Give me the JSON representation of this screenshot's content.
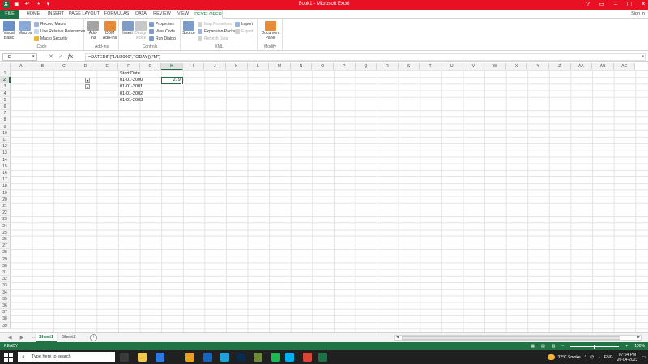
{
  "titlebar": {
    "title": "Book1 - Microsoft Excel",
    "qat": [
      "X",
      "▣",
      "↶",
      "↷",
      "▾"
    ],
    "controls": [
      "?",
      "▭",
      "–",
      "▢",
      "✕"
    ]
  },
  "tabs": [
    {
      "label": "FILE",
      "kind": "file"
    },
    {
      "label": "HOME"
    },
    {
      "label": "INSERT"
    },
    {
      "label": "PAGE LAYOUT"
    },
    {
      "label": "FORMULAS"
    },
    {
      "label": "DATA"
    },
    {
      "label": "REVIEW"
    },
    {
      "label": "VIEW"
    },
    {
      "label": "DEVELOPER",
      "kind": "active"
    }
  ],
  "signin": "Sign in",
  "ribbon": {
    "code": {
      "label": "Code",
      "visual_basic": "Visual Basic",
      "macros": "Macros",
      "record_macro": "Record Macro",
      "use_relative": "Use Relative References",
      "macro_security": "Macro Security"
    },
    "addins": {
      "label": "Add-ins",
      "addins": "Add-Ins",
      "com_addins": "COM Add-Ins"
    },
    "controls": {
      "label": "Controls",
      "insert": "Insert",
      "design_mode": "Design Mode",
      "properties": "Properties",
      "view_code": "View Code",
      "run_dialog": "Run Dialog"
    },
    "xml": {
      "label": "XML",
      "source": "Source",
      "map_properties": "Map Properties",
      "expansion_packs": "Expansion Packs",
      "refresh_data": "Refresh Data",
      "import": "Import",
      "export": "Export"
    },
    "modify": {
      "label": "Modify",
      "document_panel": "Document Panel"
    }
  },
  "formulabar": {
    "namebox": "H2",
    "formula": "=DATEDIF(\"1/1/2000\",TODAY(),\"M\")"
  },
  "columns": [
    "A",
    "B",
    "C",
    "D",
    "E",
    "F",
    "G",
    "H",
    "I",
    "J",
    "K",
    "L",
    "M",
    "N",
    "O",
    "P",
    "Q",
    "R",
    "S",
    "T",
    "U",
    "V",
    "W",
    "X",
    "Y",
    "Z",
    "AA",
    "AB",
    "AC"
  ],
  "selected_column": "H",
  "rows": [
    "1",
    "2",
    "3",
    "4",
    "5",
    "6",
    "7",
    "8",
    "9",
    "10",
    "11",
    "12",
    "13",
    "14",
    "15",
    "16",
    "17",
    "18",
    "19",
    "20",
    "21",
    "22",
    "23",
    "24",
    "25",
    "26",
    "27",
    "28",
    "29",
    "30",
    "31",
    "32",
    "33",
    "34",
    "35",
    "36",
    "37",
    "38",
    "39"
  ],
  "selected_row": "2",
  "cells": {
    "F1": "Start Date",
    "F2": "01-01-2000",
    "F3": "01-01-2001",
    "F4": "01-01-2002",
    "F5": "01-01-2003",
    "H2": "279"
  },
  "dropdown_icon": "▾",
  "sheets": [
    {
      "label": "Sheet1",
      "active": true
    },
    {
      "label": "Sheet2",
      "active": false
    }
  ],
  "sheet_nav": [
    "◀",
    "▶",
    "…"
  ],
  "add_sheet": "+",
  "status": {
    "ready": "READY",
    "zoom": "100%",
    "minus": "–",
    "plus": "+"
  },
  "taskbar": {
    "search_placeholder": "Type here to search",
    "weather": "32°C  Smoke",
    "lang": "ENG",
    "time": "07:54 PM",
    "date": "20-04-2023",
    "apps": [
      {
        "name": "task-view-icon",
        "color": "#3a3a3a"
      },
      {
        "name": "file-explorer-icon",
        "color": "#f2c94c"
      },
      {
        "name": "mail-icon",
        "color": "#2a7ae2"
      },
      {
        "name": "chrome-icon",
        "color": "#e8a11e"
      },
      {
        "name": "outlook-icon",
        "color": "#1565c0"
      },
      {
        "name": "edge-icon",
        "color": "#1fa1d9"
      },
      {
        "name": "photoshop-icon",
        "color": "#0b2a4a"
      },
      {
        "name": "notepad-icon",
        "color": "#6d8a3a"
      },
      {
        "name": "spotify-icon",
        "color": "#1db954"
      },
      {
        "name": "skype-icon",
        "color": "#00aff0"
      },
      {
        "name": "chrome2-icon",
        "color": "#db4437"
      },
      {
        "name": "excel-icon",
        "color": "#1e7145"
      }
    ]
  },
  "colors": {
    "title_red": "#e81123",
    "excel_green": "#217346"
  }
}
